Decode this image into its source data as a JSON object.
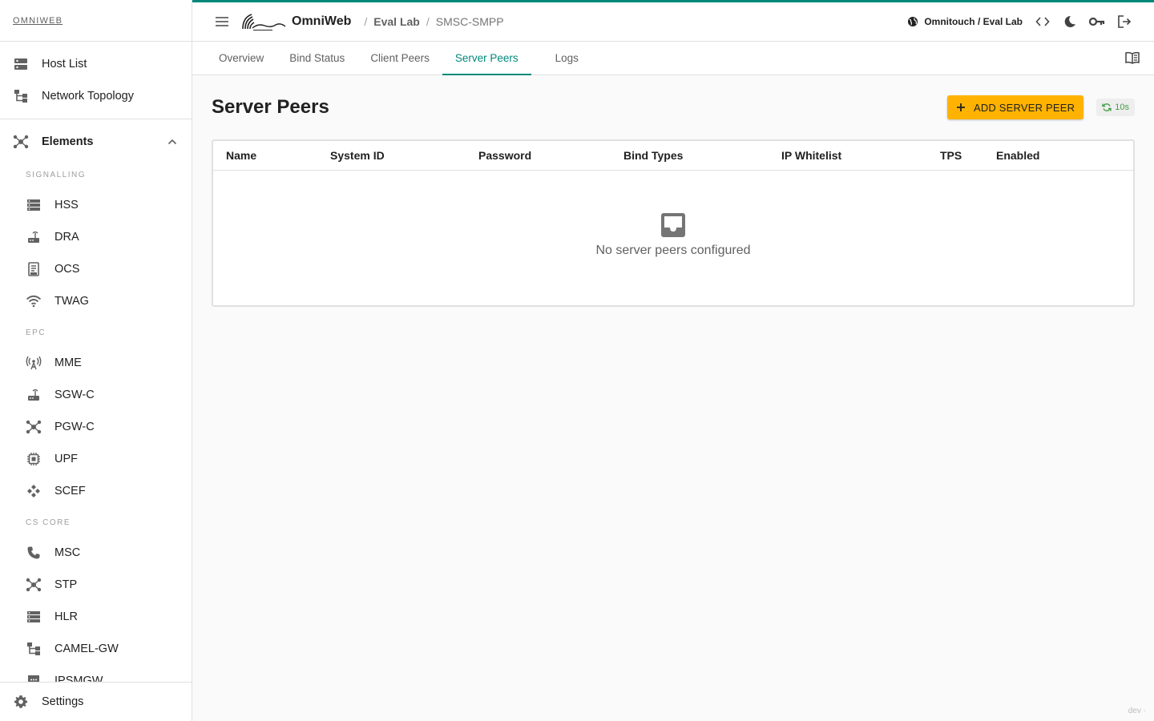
{
  "brand": {
    "label": "OMNIWEB"
  },
  "sidebar": {
    "top_items": [
      {
        "label": "Host List",
        "icon": "host-list-icon"
      },
      {
        "label": "Network Topology",
        "icon": "topology-icon"
      }
    ],
    "group": {
      "label": "Elements",
      "expanded": true
    },
    "sections": [
      {
        "label": "SIGNALLING",
        "items": [
          "HSS",
          "DRA",
          "OCS",
          "TWAG"
        ]
      },
      {
        "label": "EPC",
        "items": [
          "MME",
          "SGW-C",
          "PGW-C",
          "UPF",
          "SCEF"
        ]
      },
      {
        "label": "CS CORE",
        "items": [
          "MSC",
          "STP",
          "HLR",
          "CAMEL-GW",
          "IPSMGW"
        ]
      }
    ],
    "footer": {
      "label": "Settings"
    }
  },
  "topbar": {
    "app_name": "OmniWeb",
    "breadcrumb": {
      "lab": "Eval Lab",
      "current": "SMSC-SMPP"
    },
    "tenant": "Omnitouch / Eval Lab",
    "accent_color": "#00897b"
  },
  "tabs": [
    {
      "label": "Overview",
      "active": false
    },
    {
      "label": "Bind Status",
      "active": false
    },
    {
      "label": "Client Peers",
      "active": false
    },
    {
      "label": "Server Peers",
      "active": true
    },
    {
      "label": "Logs",
      "active": false
    }
  ],
  "page": {
    "title": "Server Peers",
    "add_button": "ADD SERVER PEER",
    "refresh_interval": "10s",
    "add_button_color": "#ffb300"
  },
  "table": {
    "columns": [
      "Name",
      "System ID",
      "Password",
      "Bind Types",
      "IP Whitelist",
      "TPS",
      "Enabled"
    ],
    "rows": [],
    "empty_message": "No server peers configured"
  },
  "env_tag": "dev ·"
}
